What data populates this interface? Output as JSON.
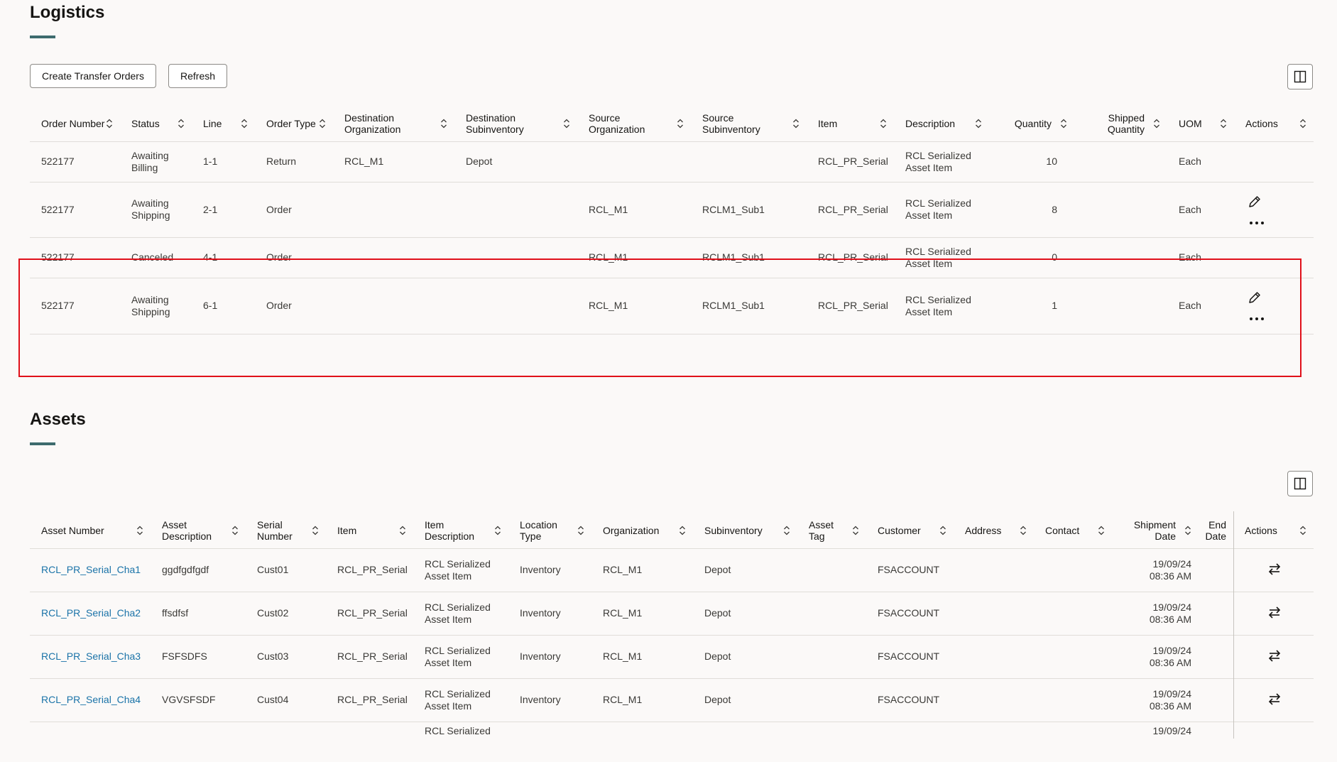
{
  "logistics": {
    "title": "Logistics",
    "buttons": {
      "create_transfer_orders": "Create Transfer Orders",
      "refresh": "Refresh"
    },
    "columns": [
      "Order Number",
      "Status",
      "Line",
      "Order Type",
      "Destination Organization",
      "Destination Subinventory",
      "Source Organization",
      "Source Subinventory",
      "Item",
      "Description",
      "Quantity",
      "Shipped Quantity",
      "UOM",
      "Actions"
    ],
    "rows": [
      {
        "order_number": "522177",
        "status": "Awaiting Billing",
        "line": "1-1",
        "order_type": "Return",
        "dest_org": "RCL_M1",
        "dest_subinv": "Depot",
        "src_org": "",
        "src_subinv": "",
        "item": "RCL_PR_Serial",
        "description": "RCL Serialized Asset Item",
        "quantity": "10",
        "shipped_quantity": "",
        "uom": "Each",
        "actions": false
      },
      {
        "order_number": "522177",
        "status": "Awaiting Shipping",
        "line": "2-1",
        "order_type": "Order",
        "dest_org": "",
        "dest_subinv": "",
        "src_org": "RCL_M1",
        "src_subinv": "RCLM1_Sub1",
        "item": "RCL_PR_Serial",
        "description": "RCL Serialized Asset Item",
        "quantity": "8",
        "shipped_quantity": "",
        "uom": "Each",
        "actions": true
      },
      {
        "order_number": "522177",
        "status": "Canceled",
        "line": "4-1",
        "order_type": "Order",
        "dest_org": "",
        "dest_subinv": "",
        "src_org": "RCL_M1",
        "src_subinv": "RCLM1_Sub1",
        "item": "RCL_PR_Serial",
        "description": "RCL Serialized Asset Item",
        "quantity": "0",
        "shipped_quantity": "",
        "uom": "Each",
        "actions": false
      },
      {
        "order_number": "522177",
        "status": "Awaiting Shipping",
        "line": "6-1",
        "order_type": "Order",
        "dest_org": "",
        "dest_subinv": "",
        "src_org": "RCL_M1",
        "src_subinv": "RCLM1_Sub1",
        "item": "RCL_PR_Serial",
        "description": "RCL Serialized Asset Item",
        "quantity": "1",
        "shipped_quantity": "",
        "uom": "Each",
        "actions": true
      }
    ]
  },
  "assets": {
    "title": "Assets",
    "columns": [
      "Asset Number",
      "Asset Description",
      "Serial Number",
      "Item",
      "Item Description",
      "Location Type",
      "Organization",
      "Subinventory",
      "Asset Tag",
      "Customer",
      "Address",
      "Contact",
      "Shipment Date",
      "End Date",
      "Actions"
    ],
    "rows": [
      {
        "asset_number": "RCL_PR_Serial_Cha1",
        "asset_description": "ggdfgdfgdf",
        "serial_number": "Cust01",
        "item": "RCL_PR_Serial",
        "item_description": "RCL Serialized Asset Item",
        "location_type": "Inventory",
        "organization": "RCL_M1",
        "subinventory": "Depot",
        "asset_tag": "",
        "customer": "FSACCOUNT",
        "address": "",
        "contact": "",
        "shipment_date": "19/09/24",
        "shipment_time": "08:36 AM",
        "end_date": ""
      },
      {
        "asset_number": "RCL_PR_Serial_Cha2",
        "asset_description": "ffsdfsf",
        "serial_number": "Cust02",
        "item": "RCL_PR_Serial",
        "item_description": "RCL Serialized Asset Item",
        "location_type": "Inventory",
        "organization": "RCL_M1",
        "subinventory": "Depot",
        "asset_tag": "",
        "customer": "FSACCOUNT",
        "address": "",
        "contact": "",
        "shipment_date": "19/09/24",
        "shipment_time": "08:36 AM",
        "end_date": ""
      },
      {
        "asset_number": "RCL_PR_Serial_Cha3",
        "asset_description": "FSFSDFS",
        "serial_number": "Cust03",
        "item": "RCL_PR_Serial",
        "item_description": "RCL Serialized Asset Item",
        "location_type": "Inventory",
        "organization": "RCL_M1",
        "subinventory": "Depot",
        "asset_tag": "",
        "customer": "FSACCOUNT",
        "address": "",
        "contact": "",
        "shipment_date": "19/09/24",
        "shipment_time": "08:36 AM",
        "end_date": ""
      },
      {
        "asset_number": "RCL_PR_Serial_Cha4",
        "asset_description": "VGVSFSDF",
        "serial_number": "Cust04",
        "item": "RCL_PR_Serial",
        "item_description": "RCL Serialized Asset Item",
        "location_type": "Inventory",
        "organization": "RCL_M1",
        "subinventory": "Depot",
        "asset_tag": "",
        "customer": "FSACCOUNT",
        "address": "",
        "contact": "",
        "shipment_date": "19/09/24",
        "shipment_time": "08:36 AM",
        "end_date": ""
      }
    ],
    "partial_row": {
      "item_description": "RCL Serialized",
      "shipment_date": "19/09/24"
    }
  },
  "icons": {
    "sort": "sort-icon",
    "columns": "columns-panel-icon",
    "edit": "pencil-icon",
    "more": "more-horizontal-icon",
    "transfer": "transfer-arrows-icon"
  },
  "colors": {
    "accent": "#3d6b6e",
    "link": "#1a73a8",
    "highlight": "#e0101a",
    "background": "#fbf9f8"
  }
}
